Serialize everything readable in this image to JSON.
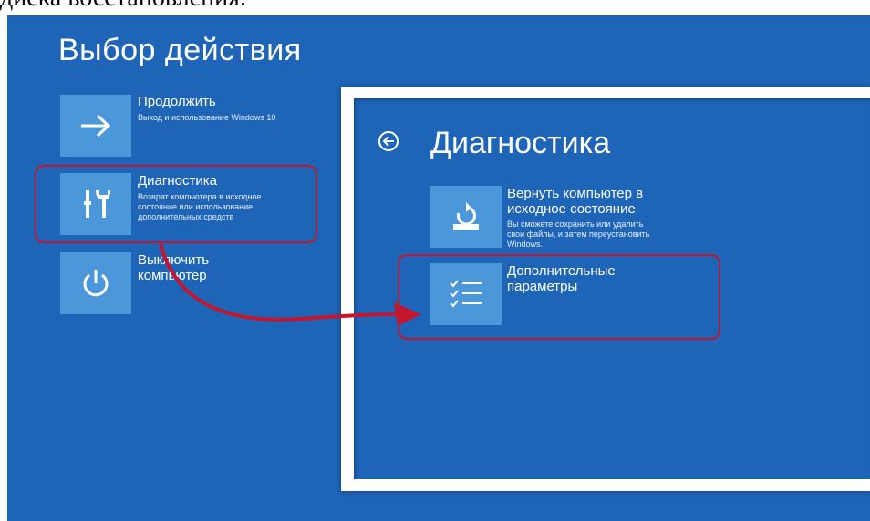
{
  "top_caption": "диска восстановления.",
  "left_screen": {
    "title": "Выбор действия",
    "options": [
      {
        "title": "Продолжить",
        "desc": [
          "Выход и использование Windows 10"
        ],
        "icon": "arrow-right-icon"
      },
      {
        "title": "Диагностика",
        "desc": [
          "Возврат компьютера в исходное",
          "состояние или использование",
          "дополнительных средств"
        ],
        "icon": "tools-icon"
      },
      {
        "title_lines": [
          "Выключить",
          "компьютер"
        ],
        "icon": "power-icon"
      }
    ]
  },
  "right_screen": {
    "title": "Диагностика",
    "options": [
      {
        "title_lines": [
          "Вернуть компьютер в",
          "исходное состояние"
        ],
        "desc": [
          "Вы сможете сохранить или удалить",
          "свои файлы, и затем переустановить",
          "Windows."
        ],
        "icon": "reset-icon"
      },
      {
        "title_lines": [
          "Дополнительные",
          "параметры"
        ],
        "icon": "checklist-icon"
      }
    ]
  },
  "colors": {
    "background": "#1e64b7",
    "tile": "#4c96da",
    "highlight": "#c5162e"
  }
}
